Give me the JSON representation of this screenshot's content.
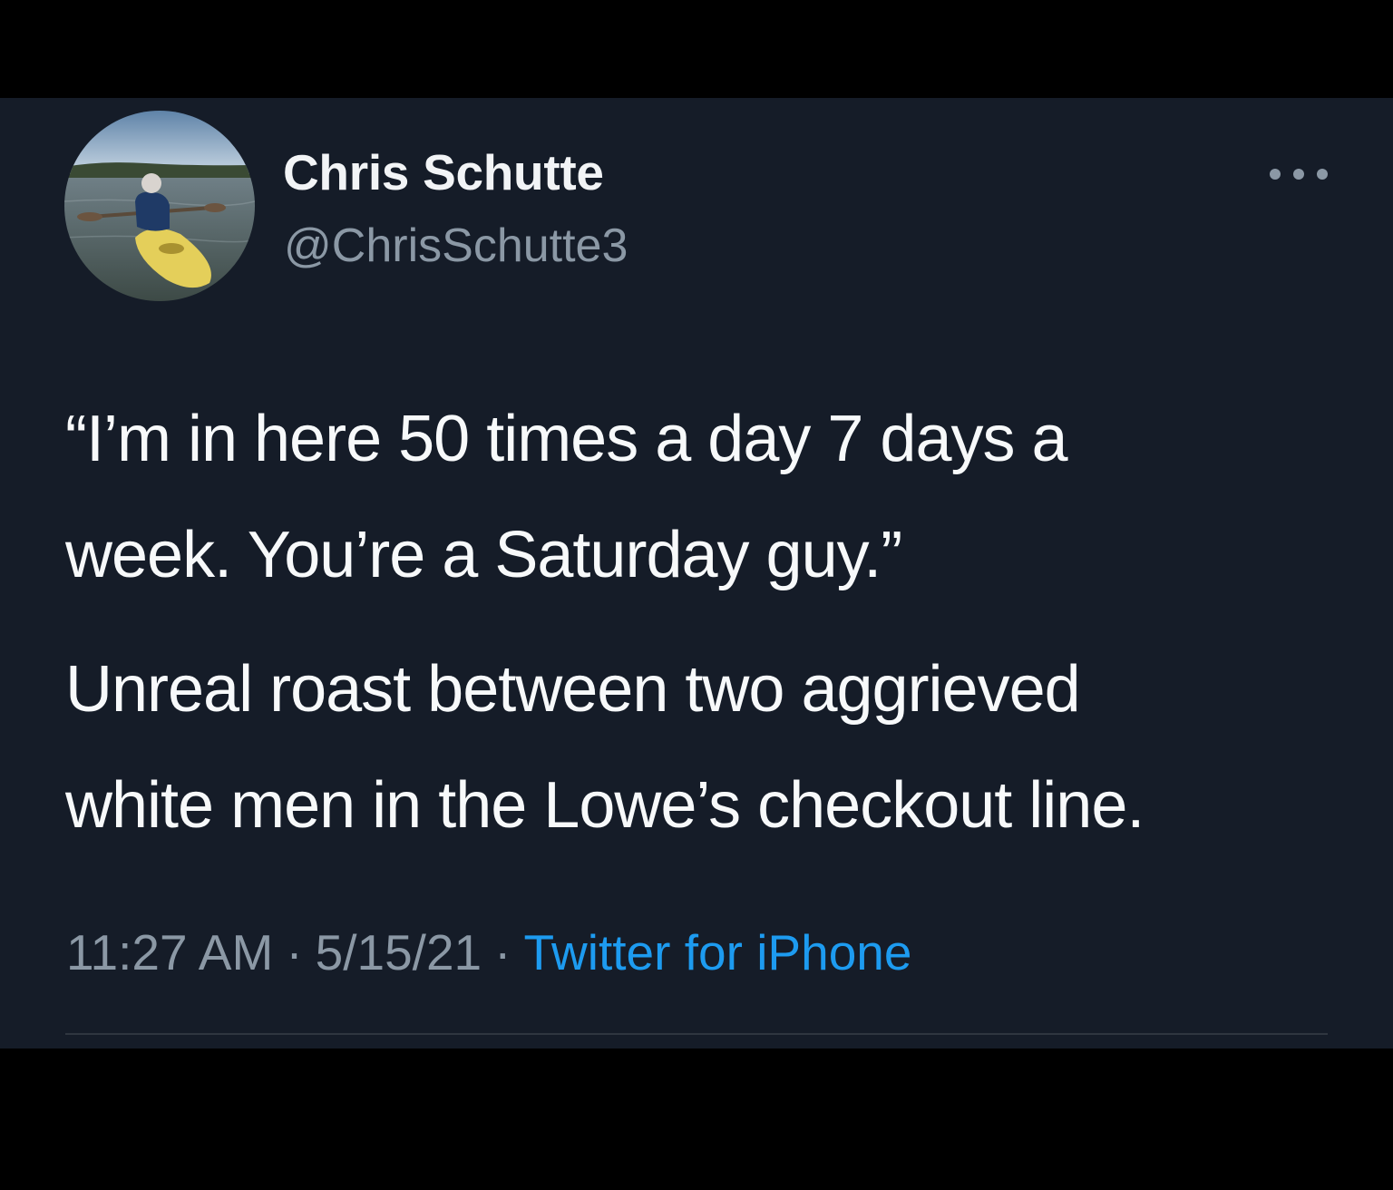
{
  "tweet": {
    "author": {
      "display_name": "Chris Schutte",
      "handle": "@ChrisSchutte3",
      "avatar_icon": "profile-photo-kayaker"
    },
    "more_icon": "more-options-icon",
    "paragraphs": [
      {
        "line1": "“I’m in here 50 times a day 7 days a",
        "line2": "week. You’re a Saturday guy.”"
      },
      {
        "line1": "Unreal roast between two aggrieved",
        "line2": "white men in the Lowe’s checkout line."
      }
    ],
    "meta": {
      "time": "11:27 AM",
      "date": "5/15/21",
      "separator": "·",
      "source": "Twitter for iPhone"
    }
  },
  "colors": {
    "background": "#151c28",
    "text_primary": "#f7f9fa",
    "text_secondary": "#8b98a5",
    "link": "#1d9bf0",
    "divider": "#2f3640"
  }
}
